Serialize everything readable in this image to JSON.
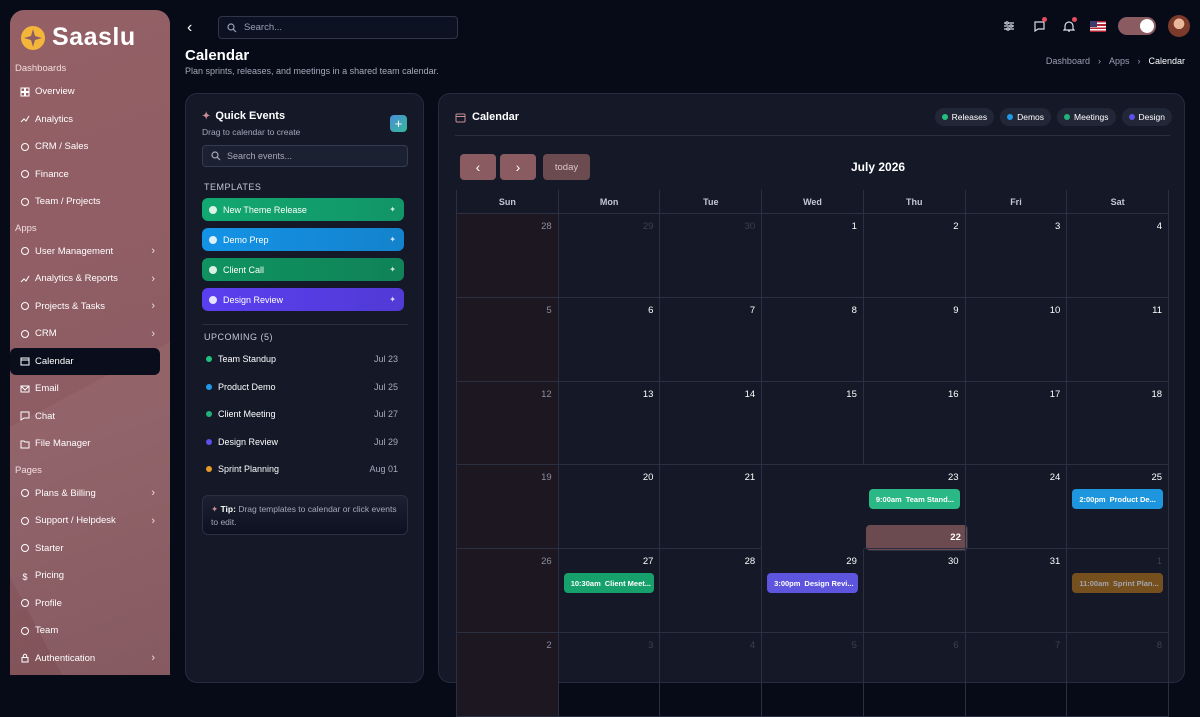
{
  "app": {
    "name": "Saaslu"
  },
  "sidebar": {
    "sections": [
      {
        "title": "Dashboards",
        "items": [
          {
            "label": "Overview",
            "icon": "grid-icon"
          },
          {
            "label": "Analytics",
            "icon": "chart-icon"
          },
          {
            "label": "CRM / Sales",
            "icon": "users-icon"
          },
          {
            "label": "Finance",
            "icon": "wallet-icon"
          },
          {
            "label": "Team / Projects",
            "icon": "briefcase-icon"
          }
        ]
      },
      {
        "title": "Apps",
        "items": [
          {
            "label": "User Management",
            "icon": "user-icon",
            "chevron": true
          },
          {
            "label": "Analytics & Reports",
            "icon": "chart-icon",
            "chevron": true
          },
          {
            "label": "Projects & Tasks",
            "icon": "clipboard-icon",
            "chevron": true
          },
          {
            "label": "CRM",
            "icon": "handshake-icon",
            "chevron": true
          },
          {
            "label": "Calendar",
            "icon": "calendar-icon",
            "active": true
          },
          {
            "label": "Email",
            "icon": "mail-icon"
          },
          {
            "label": "Chat",
            "icon": "chat-icon"
          },
          {
            "label": "File Manager",
            "icon": "folder-icon"
          }
        ]
      },
      {
        "title": "Pages",
        "items": [
          {
            "label": "Plans & Billing",
            "icon": "card-icon",
            "chevron": true
          },
          {
            "label": "Support / Helpdesk",
            "icon": "lifebuoy-icon",
            "chevron": true
          },
          {
            "label": "Starter",
            "icon": "rocket-icon"
          },
          {
            "label": "Pricing",
            "icon": "dollar-icon"
          },
          {
            "label": "Profile",
            "icon": "user-circle-icon"
          },
          {
            "label": "Team",
            "icon": "team-icon"
          },
          {
            "label": "Authentication",
            "icon": "lock-icon",
            "chevron": true
          }
        ]
      }
    ]
  },
  "topbar": {
    "search_placeholder": "Search..."
  },
  "page": {
    "title": "Calendar",
    "subtitle": "Plan sprints, releases, and meetings in a shared team calendar."
  },
  "breadcrumb": [
    "Dashboard",
    "Apps",
    "Calendar"
  ],
  "quick_events": {
    "title": "Quick Events",
    "subtitle": "Drag to calendar to create",
    "search_placeholder": "Search events...",
    "templates_label": "TEMPLATES",
    "templates": [
      {
        "label": "New Theme Release",
        "color": "#12a871"
      },
      {
        "label": "Demo Prep",
        "color": "#1493e6"
      },
      {
        "label": "Client Call",
        "color": "#0f9360"
      },
      {
        "label": "Design Review",
        "color": "#5a3ff0"
      }
    ],
    "upcoming_label": "UPCOMING (5)",
    "upcoming": [
      {
        "label": "Team Standup",
        "date": "Jul 23",
        "color": "#22c07e"
      },
      {
        "label": "Product Demo",
        "date": "Jul 25",
        "color": "#1e9be8"
      },
      {
        "label": "Client Meeting",
        "date": "Jul 27",
        "color": "#22b07a"
      },
      {
        "label": "Design Review",
        "date": "Jul 29",
        "color": "#5b50e8"
      },
      {
        "label": "Sprint Planning",
        "date": "Aug 01",
        "color": "#e89a26"
      }
    ],
    "tip_bold": "Tip:",
    "tip_text": "Drag templates to calendar or click events to edit."
  },
  "calendar": {
    "title": "Calendar",
    "legend": [
      {
        "label": "Releases",
        "color": "#22c07e"
      },
      {
        "label": "Demos",
        "color": "#1e9be8"
      },
      {
        "label": "Meetings",
        "color": "#22b07a"
      },
      {
        "label": "Design",
        "color": "#5b50e8"
      }
    ],
    "today_label": "today",
    "month": "July 2026",
    "days": [
      "Sun",
      "Mon",
      "Tue",
      "Wed",
      "Thu",
      "Fri",
      "Sat"
    ],
    "weeks": [
      [
        {
          "n": "28",
          "out": true
        },
        {
          "n": "29",
          "out": true
        },
        {
          "n": "30",
          "out": true
        },
        {
          "n": "1"
        },
        {
          "n": "2"
        },
        {
          "n": "3"
        },
        {
          "n": "4"
        }
      ],
      [
        {
          "n": "5"
        },
        {
          "n": "6"
        },
        {
          "n": "7"
        },
        {
          "n": "8"
        },
        {
          "n": "9"
        },
        {
          "n": "10"
        },
        {
          "n": "11"
        }
      ],
      [
        {
          "n": "12"
        },
        {
          "n": "13"
        },
        {
          "n": "14"
        },
        {
          "n": "15"
        },
        {
          "n": "16"
        },
        {
          "n": "17"
        },
        {
          "n": "18"
        }
      ],
      [
        {
          "n": "19"
        },
        {
          "n": "20"
        },
        {
          "n": "21"
        },
        {
          "n": "22",
          "today": true
        },
        {
          "n": "23",
          "event": {
            "time": "9:00am",
            "title": "Team Stand...",
            "color": "#2ab886"
          }
        },
        {
          "n": "24"
        },
        {
          "n": "25",
          "event": {
            "time": "2:00pm",
            "title": "Product De...",
            "color": "#1e96de"
          }
        }
      ],
      [
        {
          "n": "26"
        },
        {
          "n": "27",
          "event": {
            "time": "10:30am",
            "title": "Client Meet...",
            "color": "#16a06c"
          }
        },
        {
          "n": "28"
        },
        {
          "n": "29",
          "event": {
            "time": "3:00pm",
            "title": "Design Revi...",
            "color": "#5d55de"
          }
        },
        {
          "n": "30"
        },
        {
          "n": "31"
        },
        {
          "n": "1",
          "out": true,
          "event": {
            "time": "11:00am",
            "title": "Sprint Plan...",
            "color": "#b8741a",
            "faded": true
          }
        }
      ],
      [
        {
          "n": "2",
          "out": true
        },
        {
          "n": "3",
          "out": true
        },
        {
          "n": "4",
          "out": true
        },
        {
          "n": "5",
          "out": true
        },
        {
          "n": "6",
          "out": true
        },
        {
          "n": "7",
          "out": true
        },
        {
          "n": "8",
          "out": true
        }
      ]
    ]
  }
}
